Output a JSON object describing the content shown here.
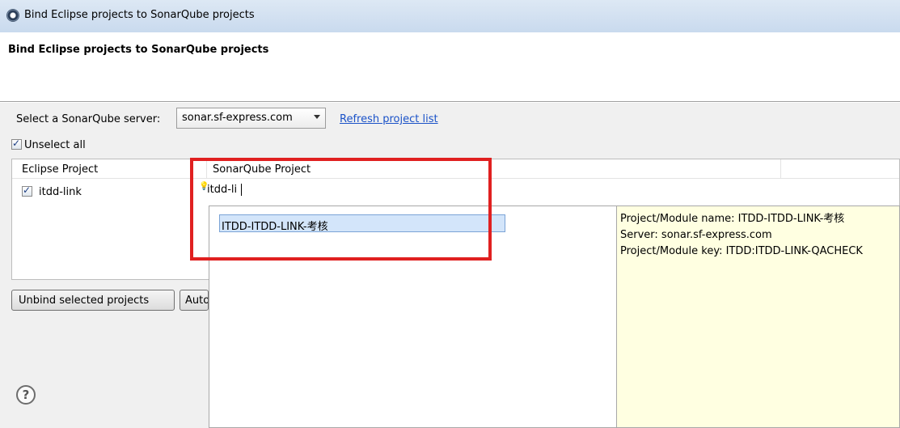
{
  "window": {
    "title": "Bind Eclipse projects to SonarQube projects"
  },
  "header": {
    "heading": "Bind Eclipse projects to SonarQube projects"
  },
  "server": {
    "label": "Select a SonarQube server:",
    "selected": "sonar.sf-express.com",
    "refresh_link": "Refresh project list"
  },
  "unselect_all": {
    "label": "Unselect all",
    "checked": true
  },
  "table": {
    "columns": [
      "Eclipse Project",
      "SonarQube Project"
    ],
    "rows": [
      {
        "eclipse_project": "itdd-link",
        "checked": true,
        "sonar_project_input": "itdd-li"
      }
    ]
  },
  "buttons": {
    "unbind": "Unbind selected projects",
    "auto": "Auto"
  },
  "autocomplete": {
    "items": [
      "ITDD-ITDD-LINK-考核"
    ],
    "info": {
      "name_line": "Project/Module name: ITDD-ITDD-LINK-考核",
      "server_line": "Server: sonar.sf-express.com",
      "key_line": "Project/Module key: ITDD:ITDD-LINK-QACHECK"
    }
  },
  "colors": {
    "highlight_box": "#e02020",
    "link": "#1a52c8",
    "tooltip_bg": "#ffffe1",
    "selection_bg": "#d3e5fa"
  },
  "icons": {
    "app": "eclipse-gear-icon",
    "help": "help-question-icon",
    "bulb": "content-assist-bulb-icon"
  }
}
